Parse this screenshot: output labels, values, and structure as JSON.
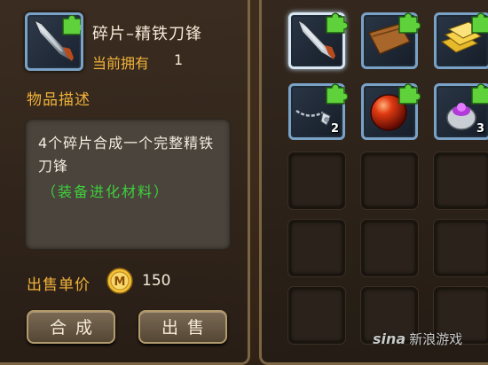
{
  "detail": {
    "item_name": "碎片–精铁刀锋",
    "owned_label": "当前拥有",
    "owned_count": "1",
    "description_heading": "物品描述",
    "description_text": "4个碎片合成一个完整精铁刀锋",
    "description_tag": "（装备进化材料）",
    "price_label": "出售单价",
    "price_value": "150",
    "price_icon": "gold-coin-m-icon"
  },
  "buttons": {
    "combine_label": "合成",
    "sell_label": "出售"
  },
  "inventory": {
    "slots": [
      {
        "icon": "blade-fragment",
        "selected": true,
        "count": ""
      },
      {
        "icon": "leather-scroll-fragment",
        "selected": false,
        "count": ""
      },
      {
        "icon": "gold-bars-fragment",
        "selected": false,
        "count": ""
      },
      {
        "icon": "chain-necklace-fragment",
        "selected": false,
        "count": "2"
      },
      {
        "icon": "red-orb-fragment",
        "selected": false,
        "count": ""
      },
      {
        "icon": "purple-potion-fragment",
        "selected": false,
        "count": "3"
      }
    ]
  },
  "watermark": {
    "brand": "sina",
    "text": "新浪游戏"
  },
  "colors": {
    "accent_gold": "#f0b23a",
    "tag_green": "#3fcf3c",
    "slot_border_blue": "#7aa2c7",
    "puzzle_green": "#5fd13b"
  }
}
